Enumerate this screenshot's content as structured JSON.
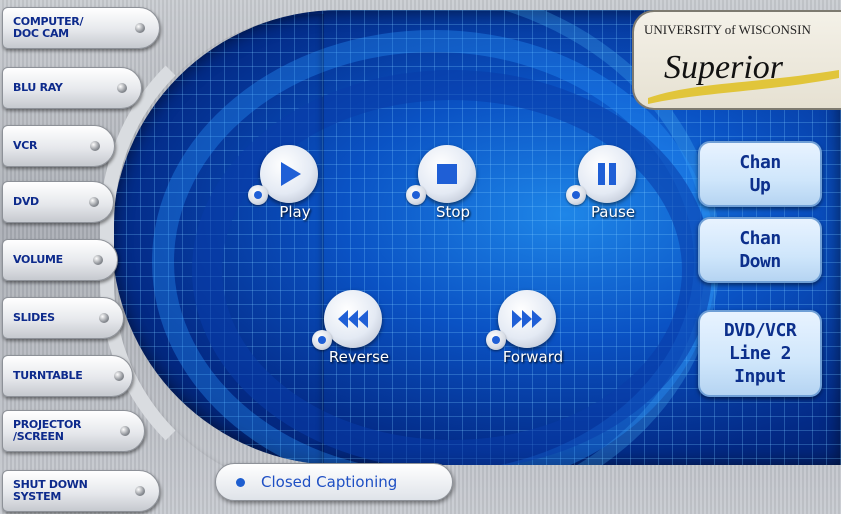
{
  "sidebar": {
    "items": [
      {
        "label": "COMPUTER/ DOC CAM"
      },
      {
        "label": "BLU RAY"
      },
      {
        "label": "VCR"
      },
      {
        "label": "DVD"
      },
      {
        "label": "VOLUME"
      },
      {
        "label": "SLIDES"
      },
      {
        "label": "TURNTABLE"
      },
      {
        "label": "PROJECTOR /SCREEN"
      },
      {
        "label": "SHUT DOWN SYSTEM"
      }
    ]
  },
  "transport": {
    "play": "Play",
    "stop": "Stop",
    "pause": "Pause",
    "reverse": "Reverse",
    "forward": "Forward"
  },
  "right_panel": {
    "chan_up": "Chan Up",
    "chan_down": "Chan Down",
    "line_input": "DVD/VCR Line 2 Input"
  },
  "logo": {
    "line1": "UNIVERSITY of WISCONSIN",
    "line2": "Superior"
  },
  "footer": {
    "closed_captioning": "Closed Captioning"
  },
  "colors": {
    "accent": "#0d2a8c",
    "screen_blue": "#0a52c4"
  }
}
